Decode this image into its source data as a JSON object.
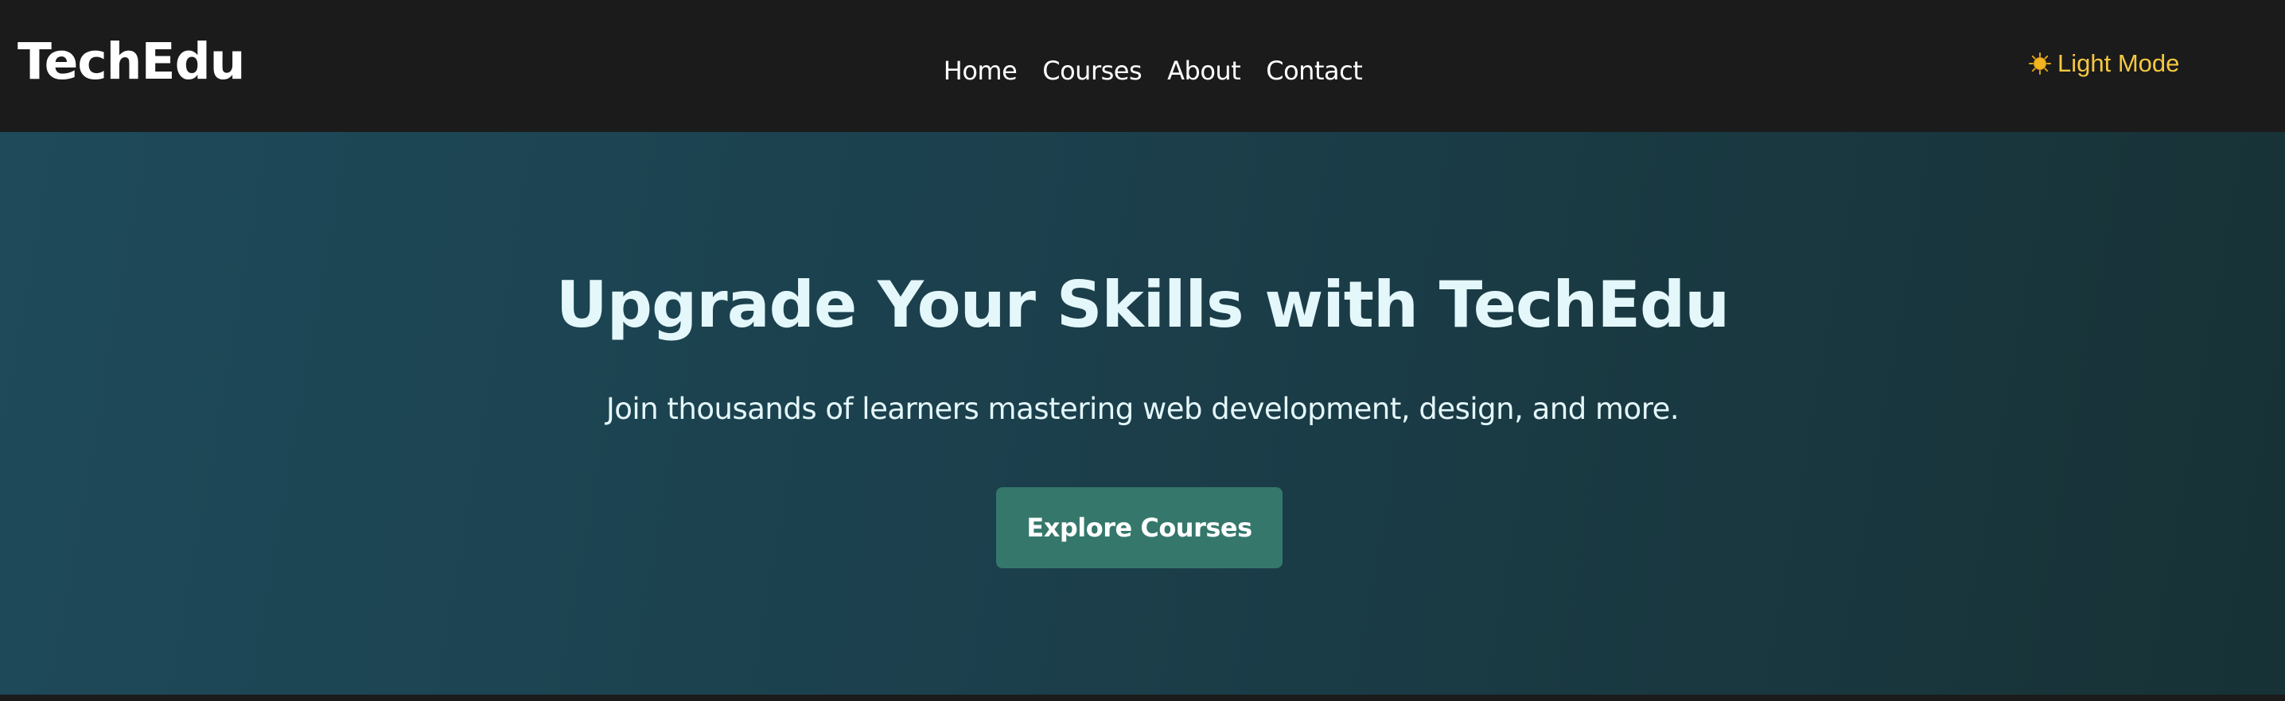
{
  "header": {
    "logo": "TechEdu",
    "nav": [
      {
        "label": "Home"
      },
      {
        "label": "Courses"
      },
      {
        "label": "About"
      },
      {
        "label": "Contact"
      }
    ],
    "theme_toggle": {
      "icon": "sun-icon",
      "label": "Light Mode"
    }
  },
  "hero": {
    "title": "Upgrade Your Skills with TechEdu",
    "subtitle": "Join thousands of learners mastering web development, design, and more.",
    "cta_label": "Explore Courses"
  },
  "colors": {
    "header_bg": "#1b1b1b",
    "hero_gradient_start": "#1e4a5a",
    "hero_gradient_end": "#173236",
    "cta_bg": "#35786b",
    "toggle_text": "#f5c842",
    "hero_text": "#e4f7fa"
  }
}
